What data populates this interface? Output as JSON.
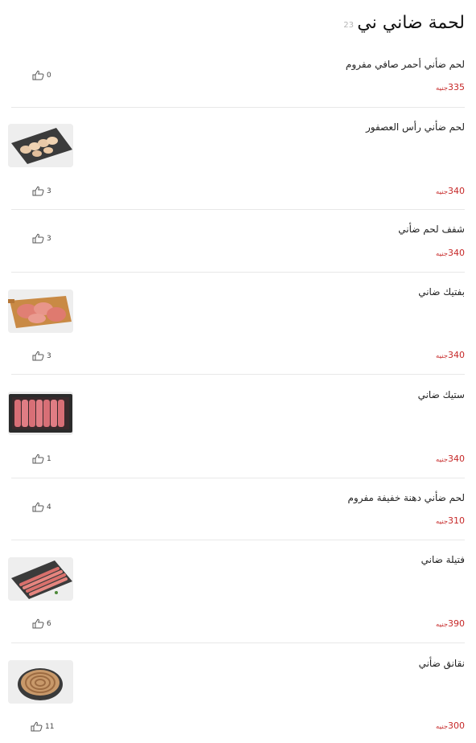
{
  "category": {
    "title": "لحمة ضاني ني",
    "count": "23"
  },
  "currency": "جنيه",
  "items": [
    {
      "name": "لحم ضأني أحمر صافي مفروم",
      "price": "335",
      "likes": "0",
      "image": null
    },
    {
      "name": "لحم ضأني رأس العصفور",
      "price": "340",
      "likes": "3",
      "image": "meat-pieces-on-slate-board"
    },
    {
      "name": "شفف لحم ضأني",
      "price": "340",
      "likes": "3",
      "image": null
    },
    {
      "name": "بفتيك ضاني",
      "price": "340",
      "likes": "3",
      "image": "escalopes-on-wooden-board"
    },
    {
      "name": "ستيك ضاني",
      "price": "340",
      "likes": "1",
      "image": "steaks-in-tray"
    },
    {
      "name": "لحم ضأني دهنة خفيفة مفروم",
      "price": "310",
      "likes": "4",
      "image": null
    },
    {
      "name": "فتيلة ضاني",
      "price": "390",
      "likes": "6",
      "image": "strips-on-slate-board"
    },
    {
      "name": "نقانق ضأني",
      "price": "300",
      "likes": "11",
      "image": "sausage-coil-on-plate"
    }
  ],
  "colors": {
    "price": "#c62828",
    "separator": "#e8e8e8",
    "count": "#b5b5b5"
  }
}
